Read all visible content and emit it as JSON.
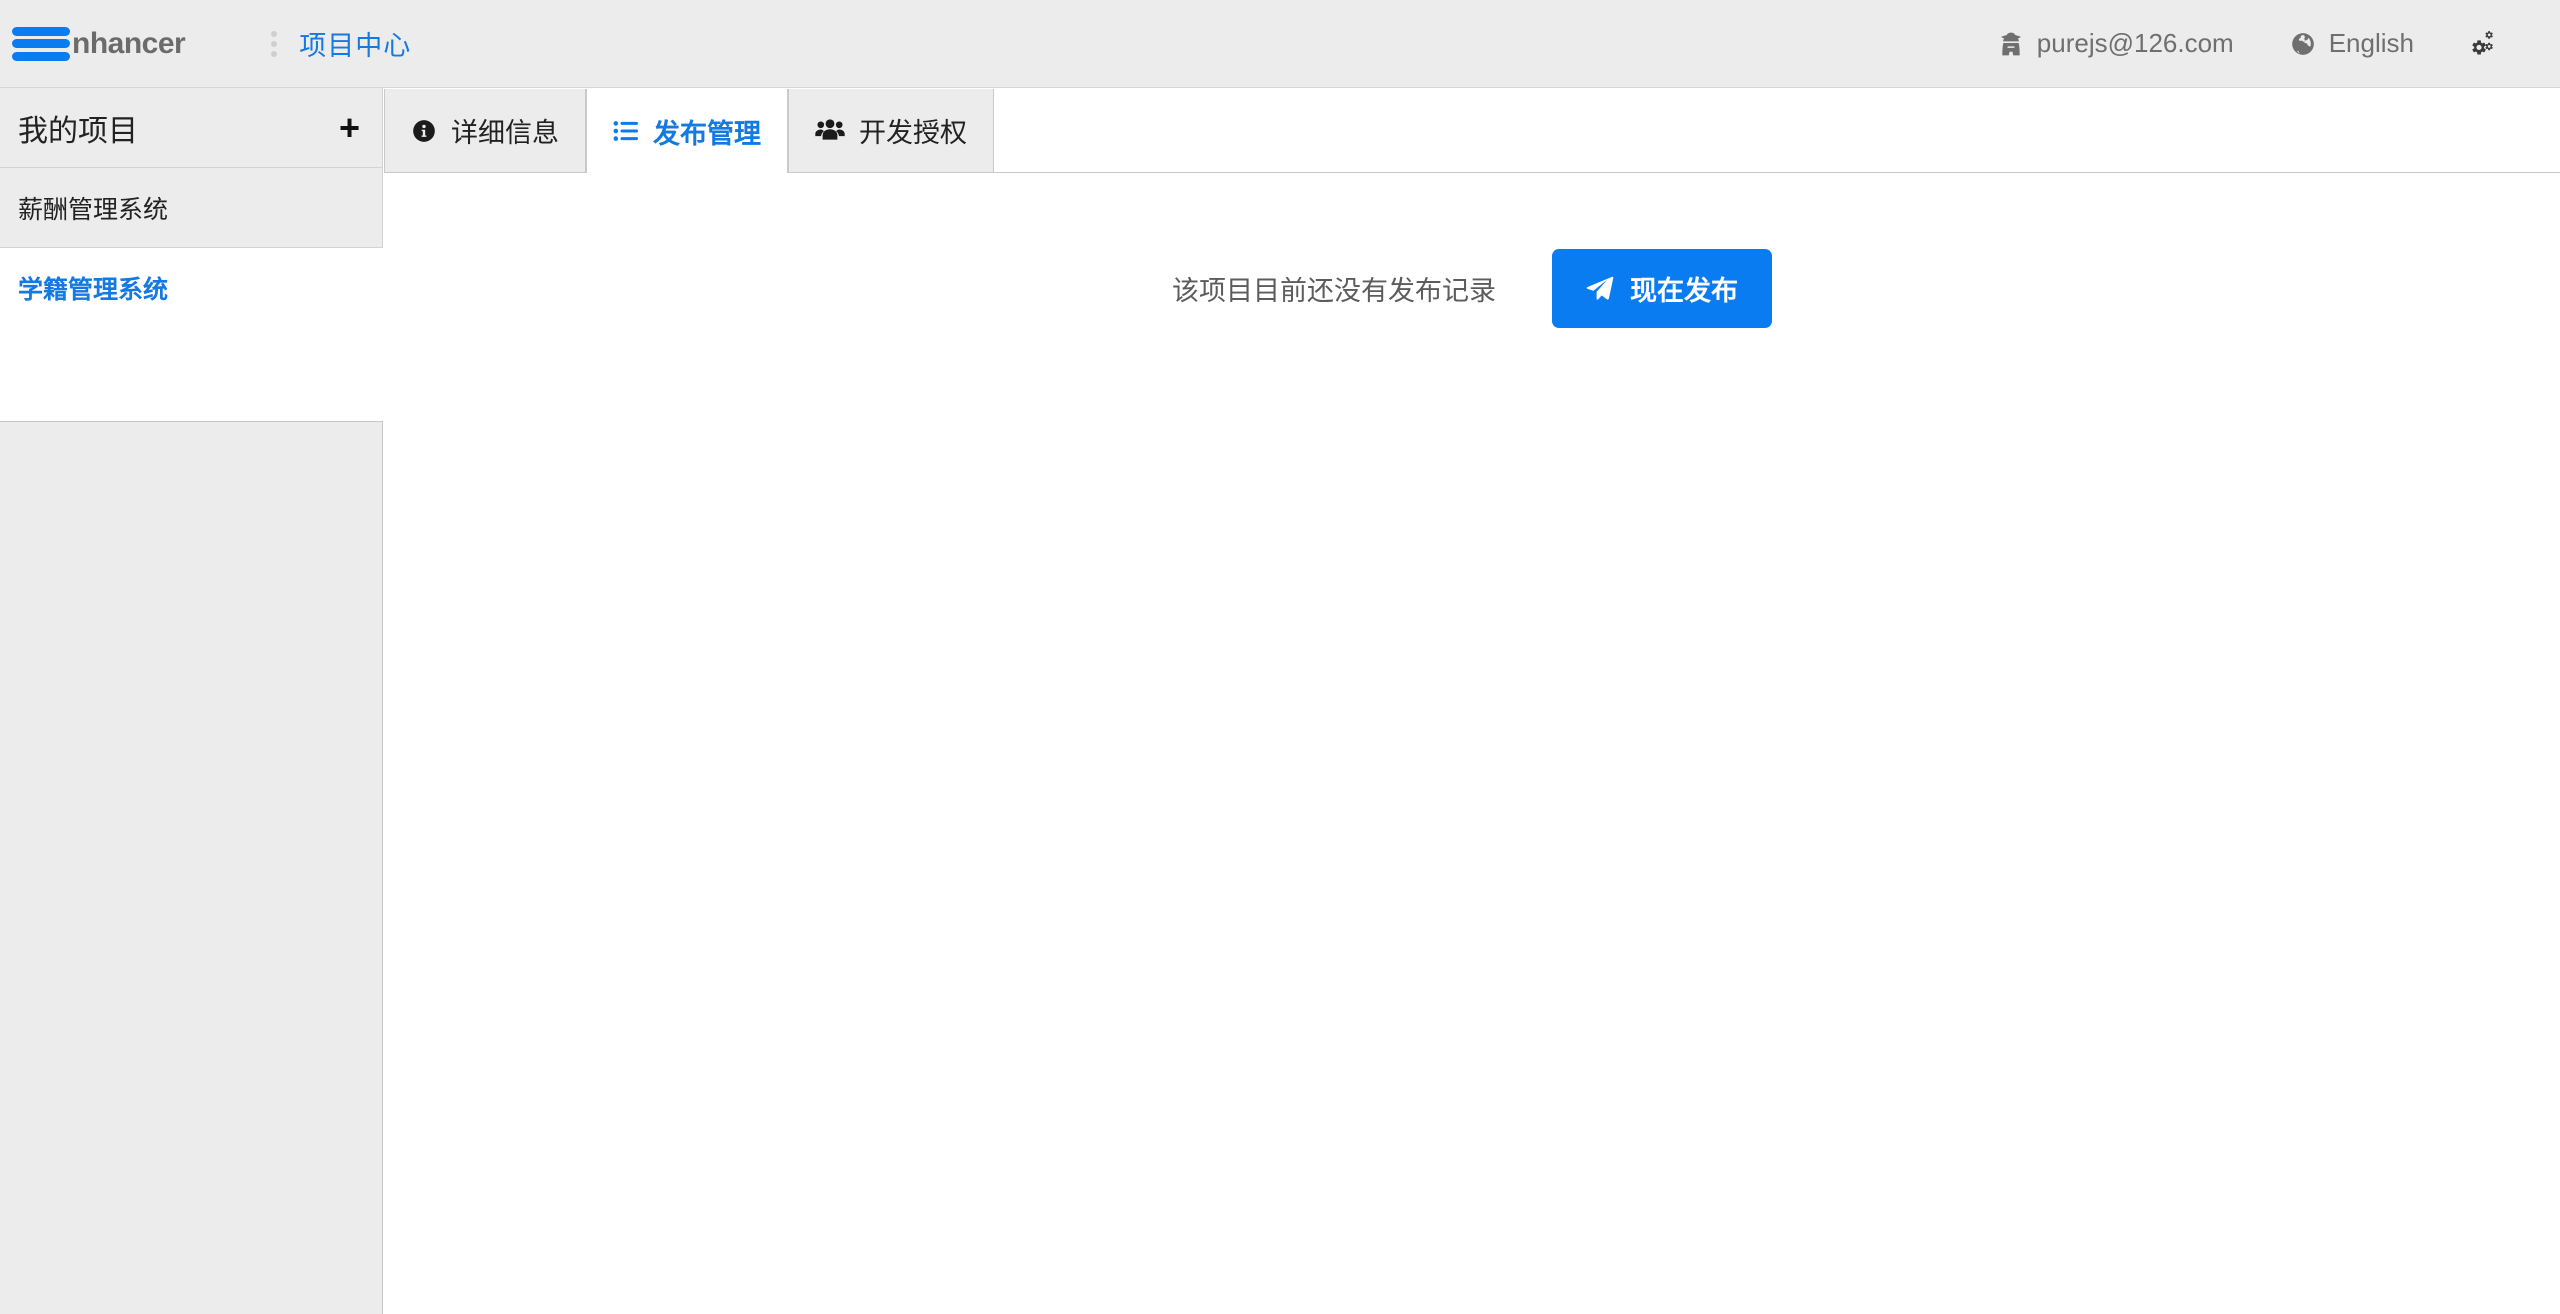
{
  "brand": {
    "mark_icon": "hamburger-bars-logo-icon",
    "name": "nhancer",
    "accent_color": "#0a7cf2"
  },
  "header": {
    "menu_icon": "ellipsis-vertical-icon",
    "breadcrumb": "项目中心",
    "account": {
      "icon": "user-secret-icon",
      "label": "purejs@126.com"
    },
    "language": {
      "icon": "globe-icon",
      "label": "English"
    },
    "settings": {
      "icon": "cogs-icon",
      "label": ""
    }
  },
  "sidebar": {
    "title": "我的项目",
    "add_label": "+",
    "add_icon": "plus-icon",
    "items": [
      {
        "label": "薪酬管理系统",
        "active": false
      },
      {
        "label": "学籍管理系统",
        "active": true
      }
    ]
  },
  "tabs": [
    {
      "label": "详细信息",
      "icon": "info-circle-icon",
      "active": false
    },
    {
      "label": "发布管理",
      "icon": "list-ul-icon",
      "active": true
    },
    {
      "label": "开发授权",
      "icon": "users-group-icon",
      "active": false
    }
  ],
  "main": {
    "empty_message": "该项目目前还没有发布记录",
    "publish_button": {
      "label": "现在发布",
      "icon": "paper-plane-icon",
      "color": "#0a7cf2"
    }
  },
  "colors": {
    "accent": "#0a7cf2",
    "link": "#1479e0",
    "panel_gray": "#ececec",
    "border_gray": "#c9c9c9",
    "text": "#222222"
  }
}
